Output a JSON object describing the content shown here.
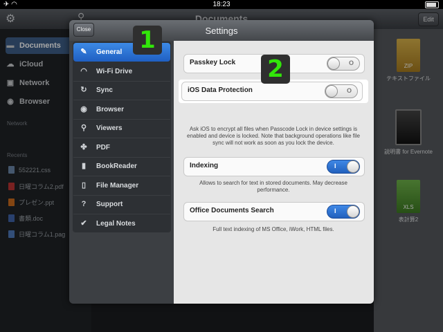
{
  "status_bar": {
    "time": "18:23"
  },
  "background": {
    "nav_title": "Documents",
    "edit_label": "Edit",
    "sidebar": [
      {
        "label": "Documents",
        "icon": "folder-icon"
      },
      {
        "label": "iCloud",
        "icon": "cloud-icon"
      },
      {
        "label": "Network",
        "icon": "car-icon"
      },
      {
        "label": "Browser",
        "icon": "compass-icon"
      }
    ],
    "network_section": "Network",
    "recents_section": "Recents",
    "recents": [
      "552221.css",
      "日曜コラム2.pdf",
      "プレゼン.ppt",
      "書類.doc",
      "日曜コラム1.pag"
    ],
    "files": [
      {
        "label": "テキストファイル",
        "badge": "ZIP"
      },
      {
        "label": "説明書 for Evernote",
        "badge": ""
      },
      {
        "label": "表計算2",
        "badge": "XLS"
      }
    ]
  },
  "settings": {
    "title": "Settings",
    "close_label": "Close",
    "menu": [
      {
        "label": "General",
        "icon": "wrench-icon",
        "active": true
      },
      {
        "label": "Wi-Fi Drive",
        "icon": "wifi-icon"
      },
      {
        "label": "Sync",
        "icon": "sync-icon"
      },
      {
        "label": "Browser",
        "icon": "compass-icon"
      },
      {
        "label": "Viewers",
        "icon": "search-icon"
      },
      {
        "label": "PDF",
        "icon": "pdf-icon"
      },
      {
        "label": "BookReader",
        "icon": "book-icon"
      },
      {
        "label": "File Manager",
        "icon": "document-icon"
      },
      {
        "label": "Support",
        "icon": "help-icon"
      },
      {
        "label": "Legal Notes",
        "icon": "checkmark-icon"
      }
    ],
    "options": {
      "passkey_lock": {
        "label": "Passkey Lock",
        "on": false
      },
      "ios_data_protection": {
        "label": "iOS Data Protection",
        "on": false,
        "note": "Ask iOS to encrypt all files when Passcode Lock in device settings is enabled and device is locked. Note that background operations like file sync will not work as soon as you lock the device."
      },
      "indexing": {
        "label": "Indexing",
        "on": true,
        "note": "Allows to search for text in stored documents. May decrease performance."
      },
      "office_search": {
        "label": "Office Documents Search",
        "on": true,
        "note": "Full text indexing of MS Office, iWork, HTML files."
      }
    },
    "toggle_on_mark": "I",
    "toggle_off_mark": "O"
  },
  "annotations": {
    "badge_1": "1",
    "badge_2": "2"
  },
  "colors": {
    "accent": "#2a6fd6",
    "badge_text": "#32e60a"
  }
}
